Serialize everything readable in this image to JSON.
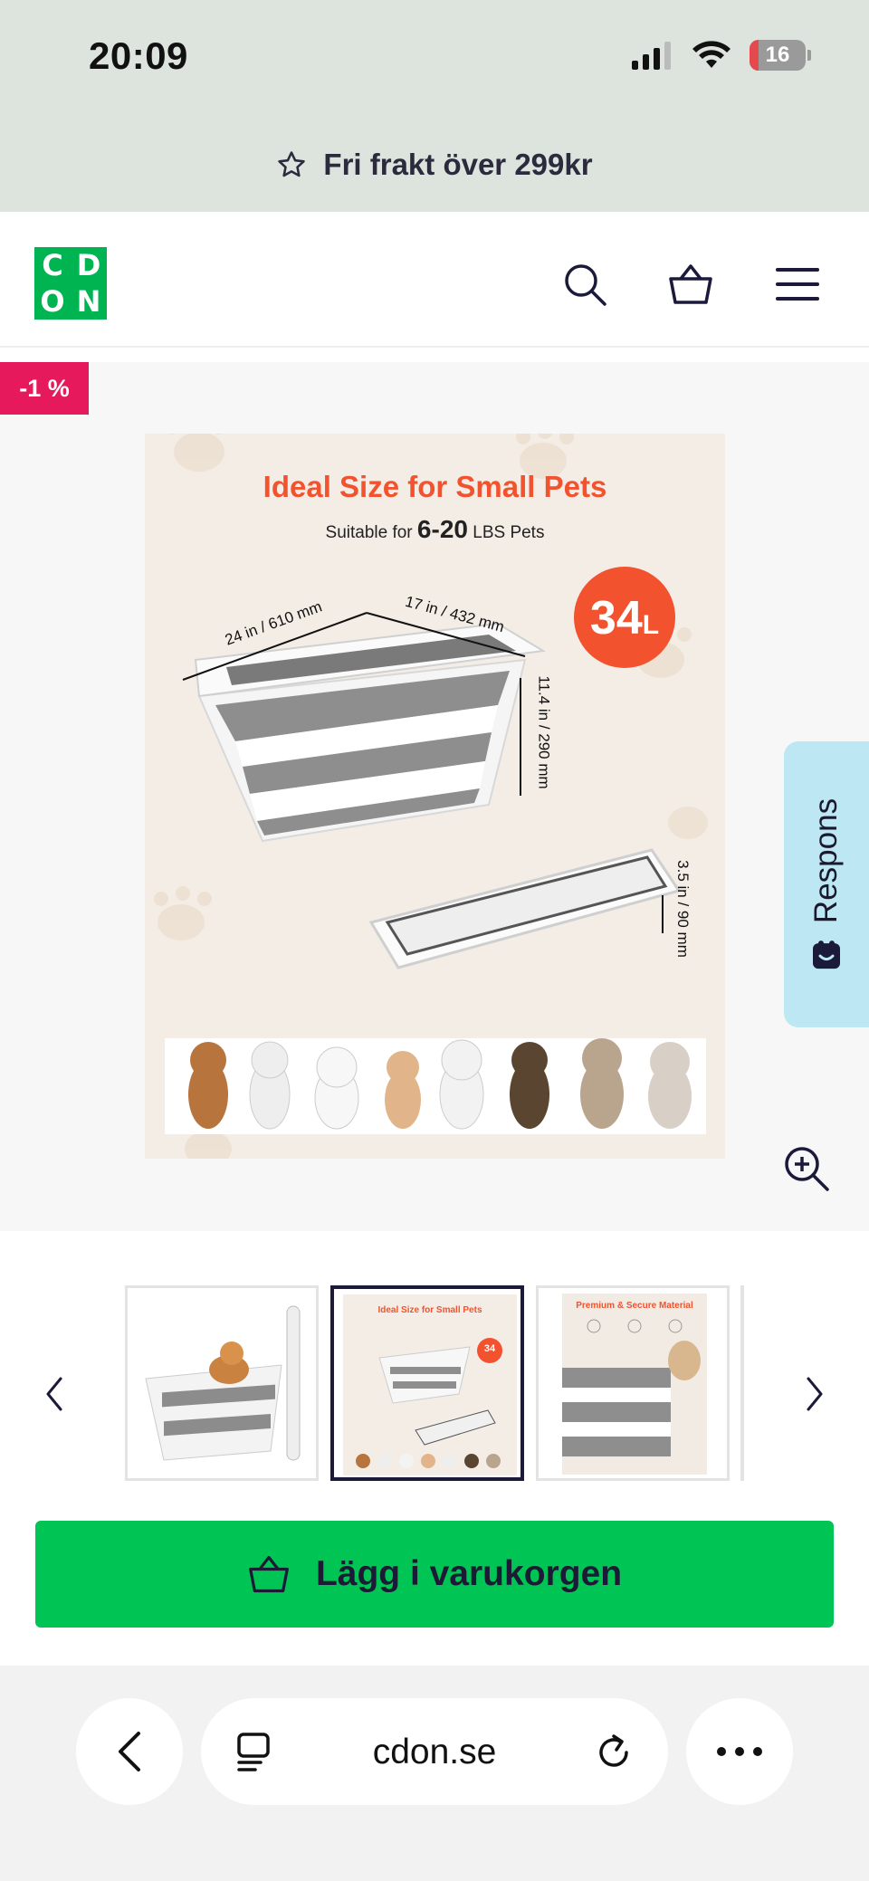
{
  "status_bar": {
    "time": "20:09",
    "battery_level": "16",
    "battery_fraction": 0.16
  },
  "promo": {
    "text": "Fri frakt över 299kr"
  },
  "header": {
    "logo_letters": [
      "C",
      "D",
      "O",
      "N"
    ]
  },
  "product": {
    "discount_badge": "-1 %",
    "image": {
      "headline": "Ideal Size for Small Pets",
      "sub_prefix": "Suitable for",
      "sub_value": "6-20",
      "sub_suffix": "LBS Pets",
      "capacity": "34",
      "capacity_unit": "L",
      "dim_length": "24 in / 610 mm",
      "dim_width": "17 in / 432 mm",
      "dim_height": "11.4 in / 290 mm",
      "dim_folded": "3.5 in / 90 mm"
    }
  },
  "feedback": {
    "label": "Respons"
  },
  "thumbnails": {
    "active_index": 1,
    "items": [
      {
        "name": "basket with dog"
      },
      {
        "name": "Ideal Size for Small Pets",
        "headline": "Ideal Size for Small Pets",
        "badge": "34"
      },
      {
        "name": "Premium & Secure Material",
        "headline": "Premium & Secure Material"
      }
    ]
  },
  "cart": {
    "label": "Lägg i varukorgen"
  },
  "browser": {
    "url": "cdon.se"
  },
  "colors": {
    "brand_green": "#00b451",
    "cart_green": "#00c454",
    "badge_pink": "#e6195c",
    "respons_blue": "#bde8f3",
    "headline_orange": "#f2522e"
  }
}
